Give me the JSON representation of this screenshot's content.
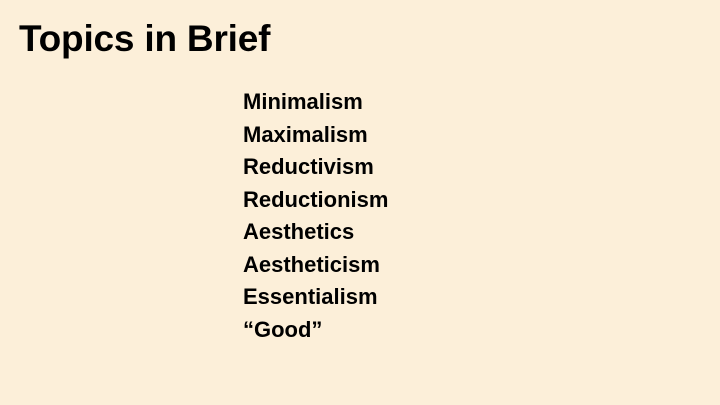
{
  "slide": {
    "title": "Topics in Brief",
    "topics": [
      "Minimalism",
      "Maximalism",
      "Reductivism",
      "Reductionism",
      "Aesthetics",
      "Aestheticism",
      "Essentialism",
      "“Good”"
    ]
  },
  "colors": {
    "background": "#fcefd9",
    "text": "#000000"
  }
}
